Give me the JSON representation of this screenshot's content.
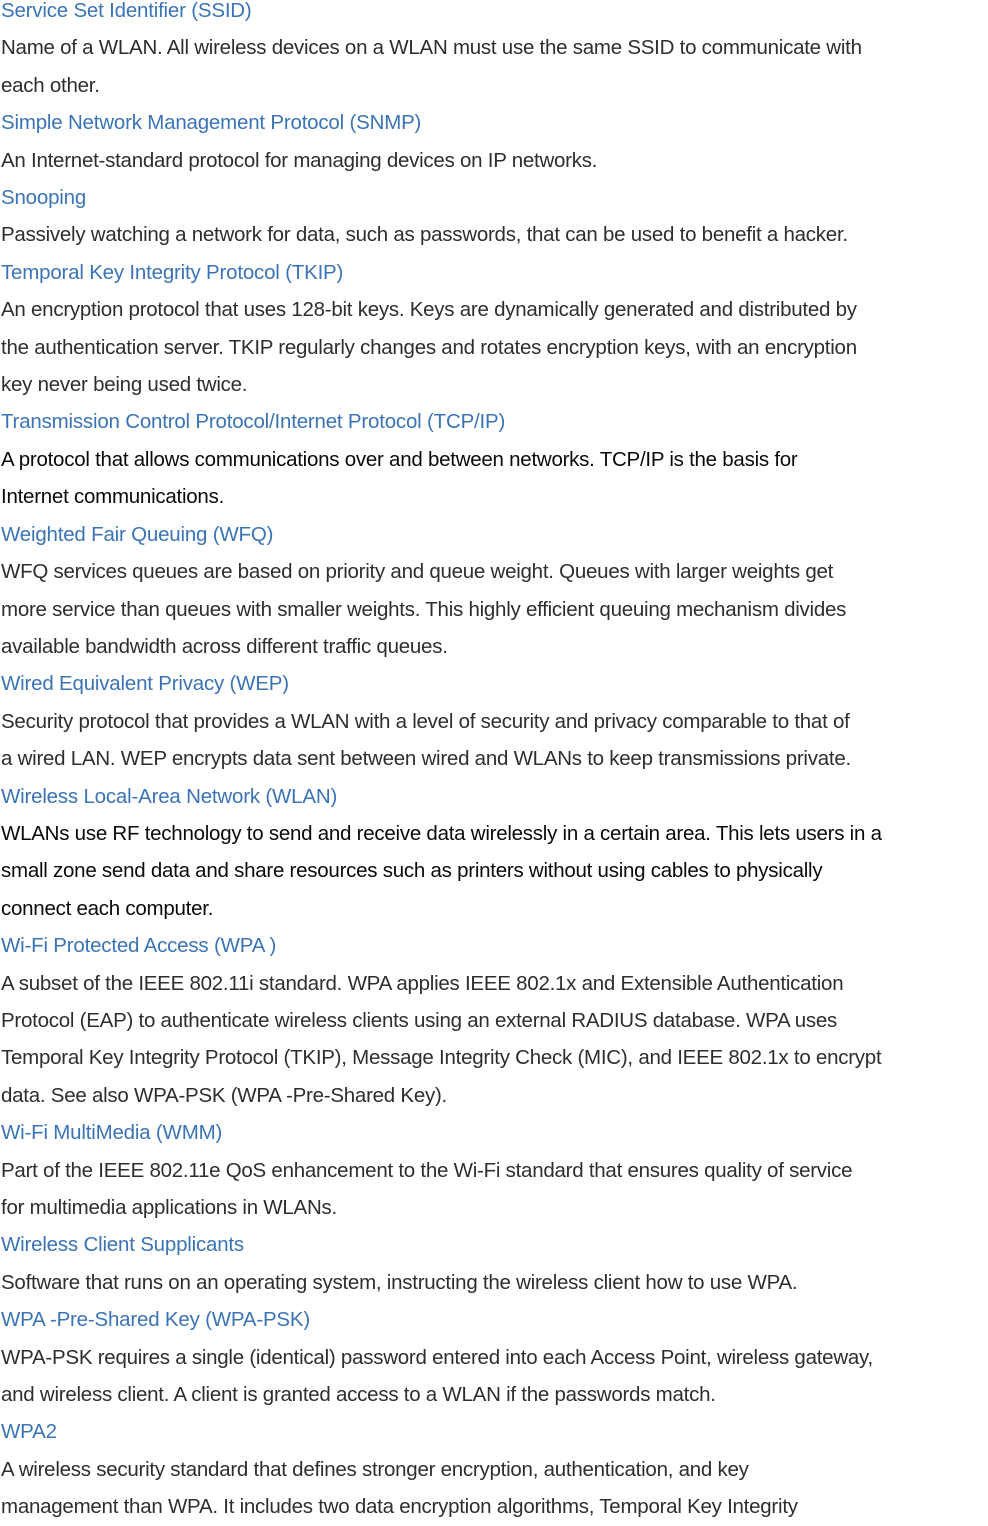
{
  "glossary": [
    {
      "term": "Service Set Identifier (SSID)",
      "lines": [
        "Name of a WLAN. All wireless devices on a WLAN must use the same  SSID to communicate with",
        "each other."
      ]
    },
    {
      "term": "Simple Network Management Protocol (SNMP)",
      "lines": [
        "An Internet-standard protocol for managing devices on IP networks."
      ]
    },
    {
      "term": "Snooping",
      "lines": [
        "Passively watching a network for data, such as passwords,  that can be used to benefit a hacker."
      ]
    },
    {
      "term": "Temporal  Key Integrity Protocol (TKIP)",
      "lines": [
        "An encryption protocol that uses 128-bit keys. Keys are dynamically generated and distributed by",
        "the authentication server. TKIP regularly  changes and rotates encryption  keys, with an encryption",
        "key never being used twice."
      ]
    },
    {
      "term": "Transmission Control Protocol/Internet Protocol (TCP/IP)",
      "lines": [
        "A protocol that allows communications over and between networks. TCP/IP is the basis for",
        "Internet communications."
      ]
    },
    {
      "term": "Weighted Fair Queuing  (WFQ)",
      "lines": [
        "WFQ services queues are based on priority and queue weight. Queues with larger weights get",
        "more  service than queues with smaller weights. This highly efficient queuing mechanism divides",
        "available bandwidth  across different traffic queues."
      ]
    },
    {
      "term": "Wired Equivalent Privacy (WEP)",
      "lines": [
        "Security protocol that provides  a WLAN with a level of security and privacy comparable to that of",
        "a wired  LAN. WEP encrypts  data sent between wired  and WLANs to keep transmissions private."
      ]
    },
    {
      "term": "Wireless Local-Area Network (WLAN)",
      "lines": [
        "WLANs  use  RF technology to send and receive data wirelessly in a certain area. This lets users in a",
        "small zone send data and share resources  such as printers without using cables to physically",
        "connect each computer."
      ]
    },
    {
      "term": "Wi-Fi Protected Access (WPA )",
      "lines": [
        "A subset of the IEEE 802.11i standard. WPA applies IEEE 802.1x and Extensible Authentication",
        "Protocol (EAP) to authenticate wireless clients using an external RADIUS database. WPA uses",
        "Temporal  Key Integrity Protocol (TKIP), Message  Integrity Check (MIC), and IEEE 802.1x to encrypt",
        "data. See also WPA-PSK (WPA  -Pre-Shared Key)."
      ]
    },
    {
      "term": "Wi-Fi MultiMedia (WMM)",
      "lines": [
        "Part of the IEEE 802.11e  QoS enhancement to the Wi-Fi standard that ensures quality of service",
        "for multimedia applications in WLANs."
      ]
    },
    {
      "term": "Wireless Client Supplicants",
      "lines": [
        "Software that runs on an operating system, instructing the wireless client how to use WPA."
      ]
    },
    {
      "term": "WPA -Pre-Shared Key (WPA-PSK)",
      "lines": [
        "WPA-PSK requires  a single (identical) password entered into each  Access Point, wireless gateway,",
        "and wireless client. A client is granted access to a WLAN if the passwords match."
      ]
    },
    {
      "term": "WPA2",
      "lines": [
        "A wireless security standard that defines stronger encryption, authentication, and key",
        "management than WPA. It includes two data encryption algorithms, Temporal  Key Integrity"
      ]
    }
  ],
  "colors": {
    "term": "#3b74b6",
    "definition": "#2e2e2e",
    "definition_emphasis": "#0a0a0a"
  }
}
